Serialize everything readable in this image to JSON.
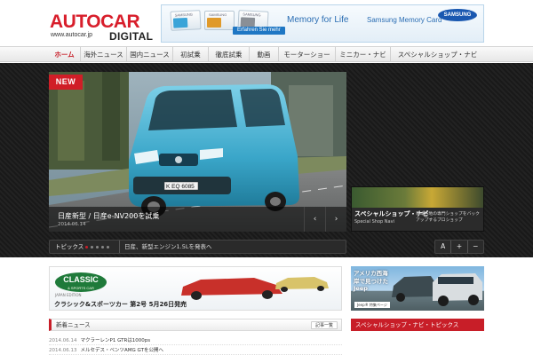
{
  "brand": {
    "name": "AUTOCAR",
    "domain": "www.autocar.jp",
    "edition": "DIGITAL",
    "color": "#d81e2b"
  },
  "top_banner": {
    "cards": [
      "SAMSUNG",
      "SAMSUNG",
      "SAMSUNG"
    ],
    "cta": "Erfahren Sie mehr",
    "headline": "Memory for Life",
    "subline": "Samsung Memory Card",
    "brand": "SAMSUNG"
  },
  "nav": {
    "items": [
      "ホーム",
      "海外ニュース",
      "国内ニュース",
      "初試乗",
      "徹底試乗",
      "動画",
      "モーターショー",
      "ミニカー・ナビ",
      "スペシャルショップ・ナビ"
    ],
    "active_index": 0
  },
  "hero": {
    "badge": "NEW",
    "title": "日産新型 / 日産e-NV200を試乗",
    "date": "2014.06.14",
    "plate": "K EQ 6085",
    "prev_icon": "‹",
    "next_icon": "›"
  },
  "side_promo": {
    "title": "スペシャルショップ・ナビ",
    "subtitle": "Special Shop Navi",
    "description": "日本各地の専門ショップをバックアップするプロショップ"
  },
  "topics": {
    "label": "トピックス",
    "text": "日産、新型エンジン1.5Lを発表へ"
  },
  "font_controls": [
    "A",
    "+",
    "−"
  ],
  "ad_classic": {
    "logo": "CLASSIC",
    "logo_sub": "& SPORTS CAR",
    "edition": "JAPAN EDITION",
    "text": "クラシック&スポーツカー 第2号 5月26日発売"
  },
  "ad_jeep": {
    "text": "アメリカ西海岸で見つけたJeep",
    "badge": "Jeep® 特集ページ"
  },
  "news_section": {
    "title": "新着ニュース",
    "more_label": "記事一覧",
    "rows": [
      {
        "date": "2014.06.14",
        "title": "マクラーレンP1 GTRは1000ps"
      },
      {
        "date": "2014.06.13",
        "title": "メルセデス・ベンツAMG GTを公開へ"
      }
    ]
  },
  "shop_section": {
    "title": "スペシャルショップ・ナビ・トピックス"
  }
}
